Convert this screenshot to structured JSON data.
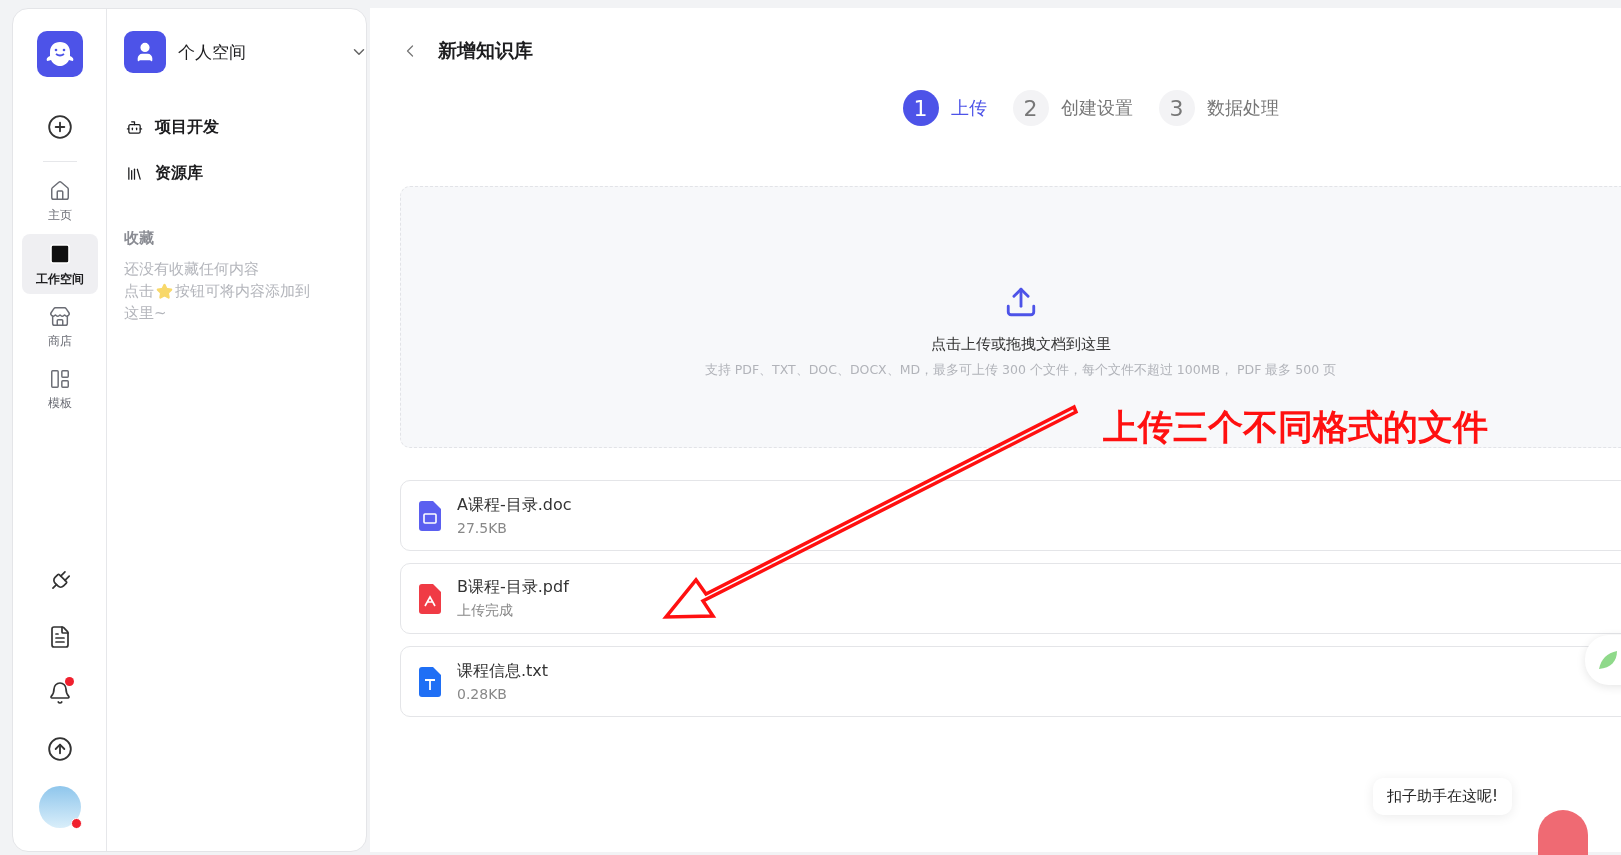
{
  "rail": {
    "top": [
      {
        "kind": "add"
      }
    ],
    "nav": [
      {
        "kind": "home",
        "label": "主页",
        "selected": false
      },
      {
        "kind": "workspace",
        "label": "工作空间",
        "selected": true
      },
      {
        "kind": "store",
        "label": "商店",
        "selected": false
      },
      {
        "kind": "template",
        "label": "模板",
        "selected": false
      }
    ],
    "bottom": [
      {
        "kind": "plugin",
        "badge": false
      },
      {
        "kind": "doc",
        "badge": false
      },
      {
        "kind": "bell",
        "badge": true
      },
      {
        "kind": "upload",
        "badge": false
      },
      {
        "kind": "avatar",
        "badge": true
      }
    ]
  },
  "space": {
    "name": "个人空间",
    "items": [
      {
        "kind": "project",
        "label": "项目开发"
      },
      {
        "kind": "library",
        "label": "资源库"
      }
    ],
    "favorites": {
      "title": "收藏",
      "empty": "还没有收藏任何内容",
      "hint_before": "点击",
      "hint_after": "按钮可将内容添加到",
      "hint_wrap": "这里~"
    }
  },
  "page": {
    "title": "新增知识库",
    "steps": [
      {
        "number": "1",
        "label": "上传",
        "selected": true
      },
      {
        "number": "2",
        "label": "创建设置",
        "selected": false
      },
      {
        "number": "3",
        "label": "数据处理",
        "selected": false
      }
    ],
    "dropzone": {
      "title": "点击上传或拖拽文档到这里",
      "hint": "支持 PDF、TXT、DOC、DOCX、MD，最多可上传 300 个文件，每个文件不超过 100MB， PDF 最多 500 页"
    },
    "files": [
      {
        "kind": "doc",
        "name": "A课程-目录.doc",
        "info": "27.5KB"
      },
      {
        "kind": "pdf",
        "name": "B课程-目录.pdf",
        "info": "上传完成"
      },
      {
        "kind": "txt",
        "name": "课程信息.txt",
        "info": "0.28KB"
      }
    ]
  },
  "assistant": {
    "tooltip": "扣子助手在这呢!"
  },
  "annotation": {
    "text": "上传三个不同格式的文件"
  }
}
